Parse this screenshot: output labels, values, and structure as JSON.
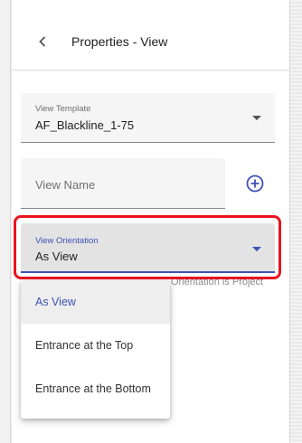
{
  "header": {
    "title": "Properties - View",
    "back_icon": "chevron-left-icon"
  },
  "view_template": {
    "label": "View Template",
    "value": "AF_Blackline_1-75"
  },
  "view_name": {
    "placeholder": "View Name",
    "add_icon": "plus-circle-icon"
  },
  "view_orientation": {
    "label": "View Orientation",
    "value": "As View",
    "helper_text": "Orientation is Project"
  },
  "dropdown": {
    "options": [
      {
        "label": "As View",
        "selected": true
      },
      {
        "label": "Entrance at the Top",
        "selected": false
      },
      {
        "label": "Entrance at the Bottom",
        "selected": false
      }
    ]
  },
  "colors": {
    "accent": "#3f51b5",
    "highlight": "#e8141e",
    "field_bg": "#f5f5f5"
  }
}
